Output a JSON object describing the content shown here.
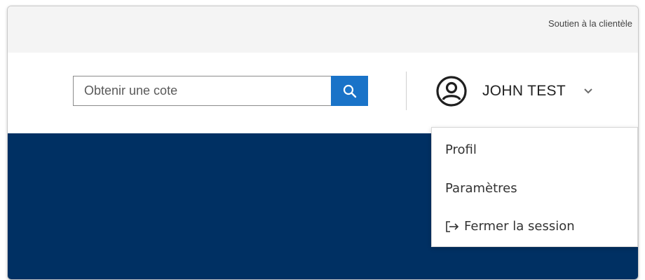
{
  "topbar": {
    "support_link": "Soutien à la clientèle"
  },
  "header": {
    "search": {
      "placeholder": "Obtenir une cote",
      "value": "",
      "button_icon": "search-icon"
    },
    "user": {
      "name": "JOHN TEST",
      "avatar_icon": "user-circle-icon",
      "menu_icon": "chevron-down-icon"
    }
  },
  "dropdown": {
    "items": [
      {
        "label": "Profil"
      },
      {
        "label": "Paramètres"
      },
      {
        "label": "Fermer la session",
        "icon": "logout-icon"
      }
    ]
  },
  "colors": {
    "accent": "#1a73c8",
    "banner": "#003063",
    "topbar": "#f4f4f4"
  }
}
